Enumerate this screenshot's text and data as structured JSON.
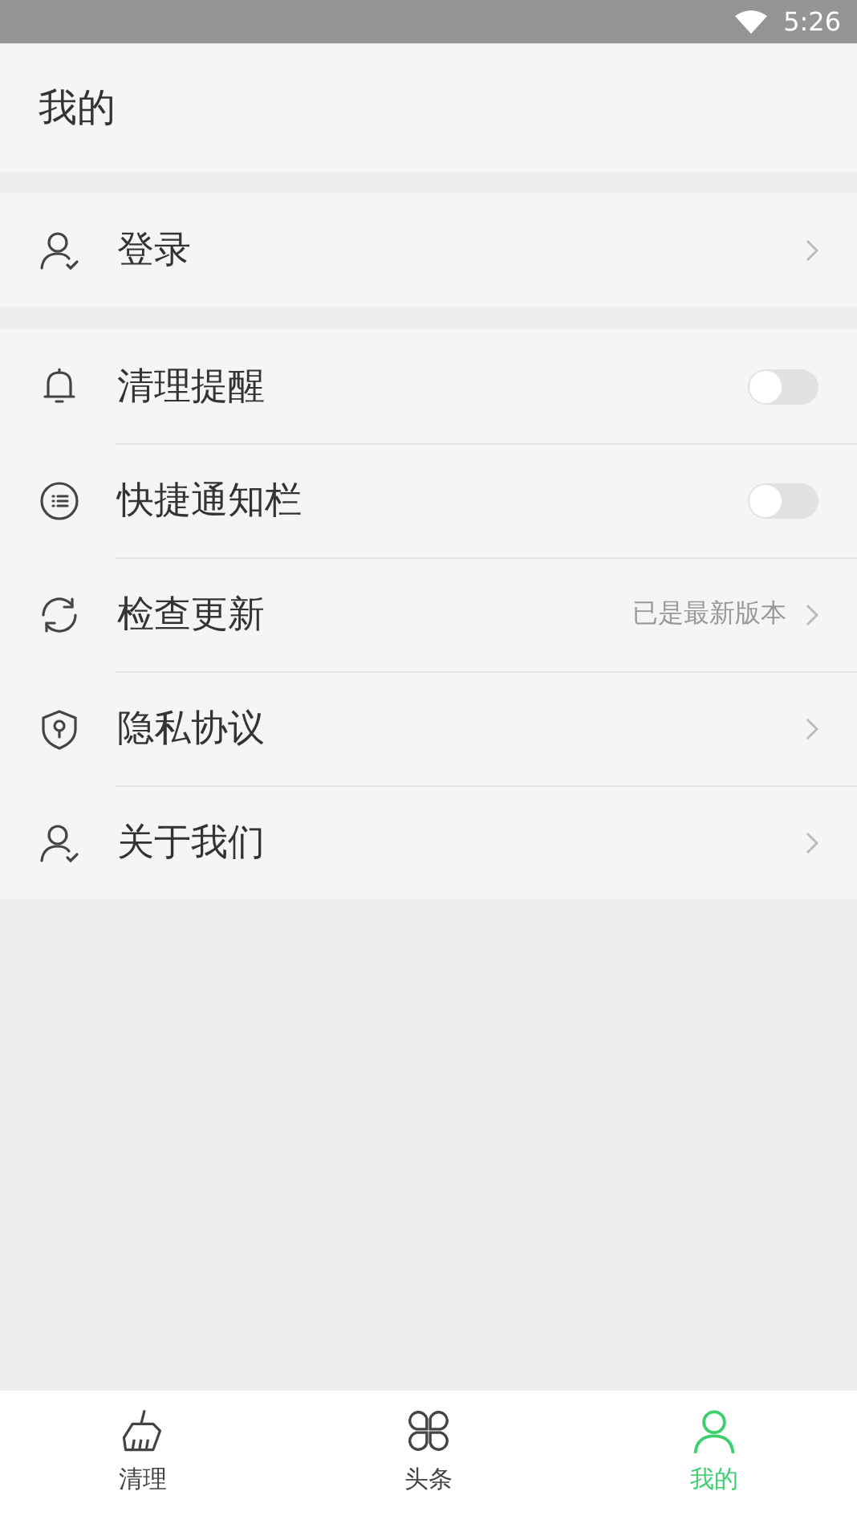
{
  "status_bar": {
    "time": "5:26"
  },
  "header": {
    "title": "我的"
  },
  "sections": [
    {
      "items": [
        {
          "kind": "link",
          "label": "登录"
        }
      ]
    },
    {
      "items": [
        {
          "kind": "toggle",
          "label": "清理提醒",
          "on": false
        },
        {
          "kind": "toggle",
          "label": "快捷通知栏",
          "on": false
        },
        {
          "kind": "link",
          "label": "检查更新",
          "value": "已是最新版本"
        },
        {
          "kind": "link",
          "label": "隐私协议"
        },
        {
          "kind": "link",
          "label": "关于我们"
        }
      ]
    }
  ],
  "tabs": [
    {
      "label": "清理",
      "selected": false
    },
    {
      "label": "头条",
      "selected": false
    },
    {
      "label": "我的",
      "selected": true
    }
  ]
}
